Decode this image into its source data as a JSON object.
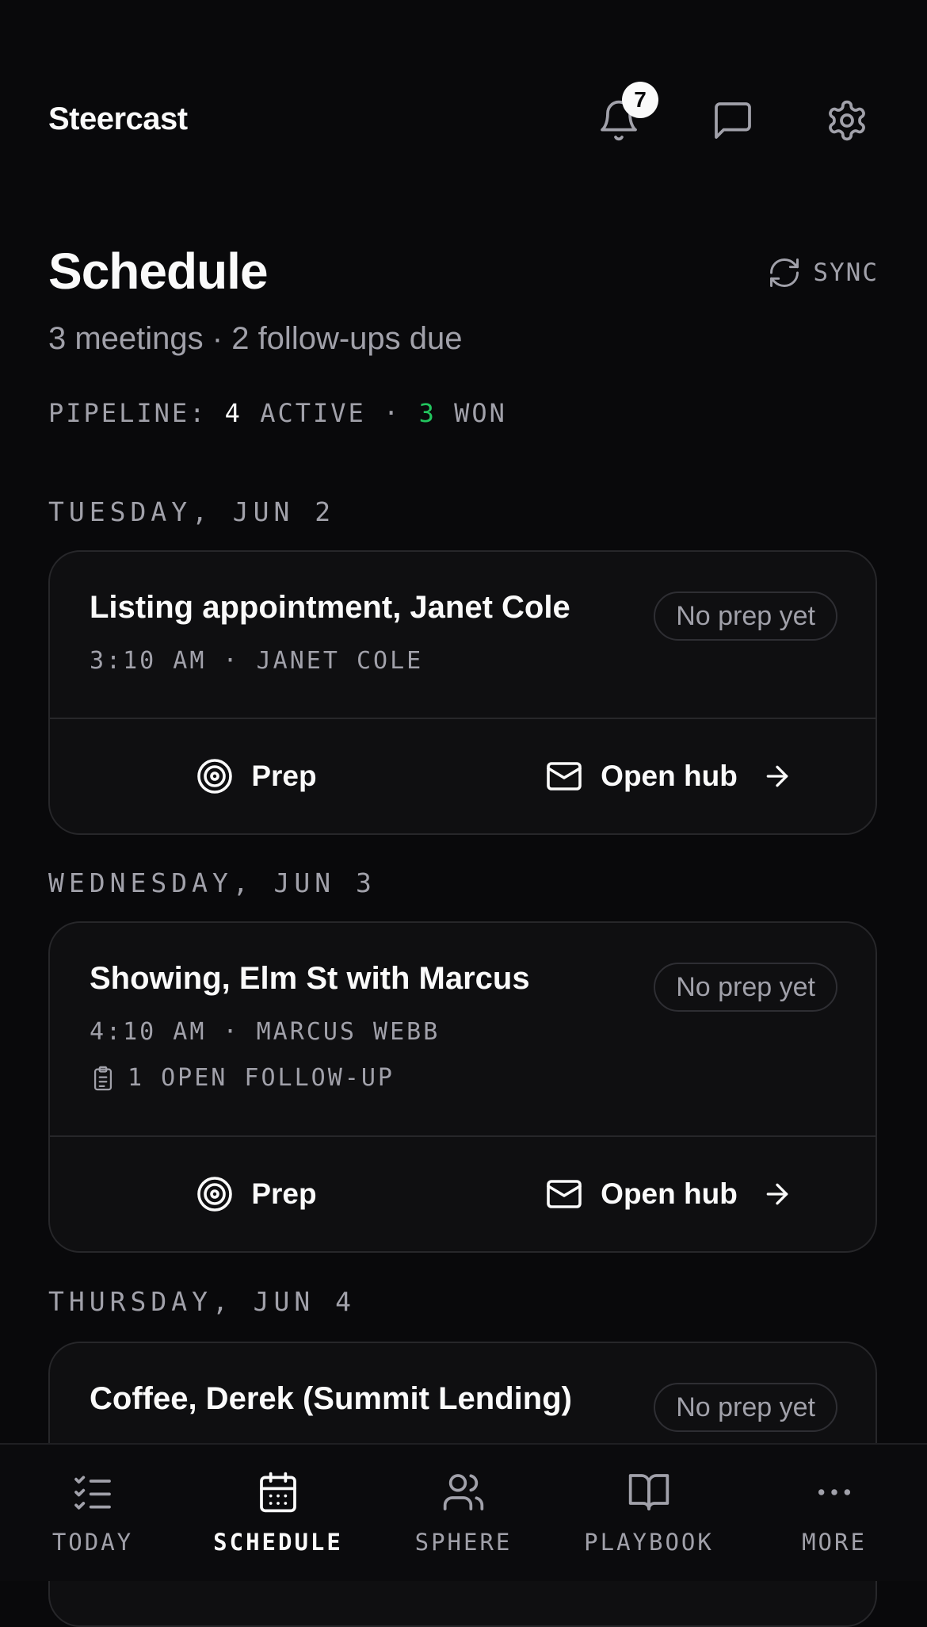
{
  "app": {
    "brand": "Steercast",
    "notifications_count": "7"
  },
  "header": {
    "title": "Schedule",
    "sync_label": "SYNC",
    "subtitle": "3 meetings · 2 follow-ups due",
    "pipeline": {
      "prefix": "PIPELINE:",
      "active_count": "4",
      "active_label": "ACTIVE",
      "separator": "·",
      "won_count": "3",
      "won_label": "WON"
    }
  },
  "days": [
    {
      "label": "TUESDAY, JUN 2",
      "meetings": [
        {
          "title": "Listing appointment, Janet Cole",
          "meta": "3:10 AM · JANET COLE",
          "prep_status": "No prep yet",
          "followup": "",
          "prep_label": "Prep",
          "hub_label": "Open hub"
        }
      ]
    },
    {
      "label": "WEDNESDAY, JUN 3",
      "meetings": [
        {
          "title": "Showing, Elm St with Marcus",
          "meta": "4:10 AM · MARCUS WEBB",
          "prep_status": "No prep yet",
          "followup": "1 OPEN FOLLOW-UP",
          "prep_label": "Prep",
          "hub_label": "Open hub"
        }
      ]
    },
    {
      "label": "THURSDAY, JUN 4",
      "meetings": [
        {
          "title": "Coffee, Derek (Summit Lending)",
          "prep_status": "No prep yet"
        }
      ]
    }
  ],
  "nav": {
    "active": "SCHEDULE",
    "items": [
      {
        "label": "TODAY",
        "icon": "checklist-icon"
      },
      {
        "label": "SCHEDULE",
        "icon": "calendar-icon"
      },
      {
        "label": "SPHERE",
        "icon": "users-icon"
      },
      {
        "label": "PLAYBOOK",
        "icon": "book-icon"
      },
      {
        "label": "MORE",
        "icon": "more-icon"
      }
    ]
  },
  "colors": {
    "background": "#09090b",
    "card": "#0f0f11",
    "border": "#27272a",
    "muted": "#a1a1aa",
    "won_accent": "#22c55e"
  }
}
